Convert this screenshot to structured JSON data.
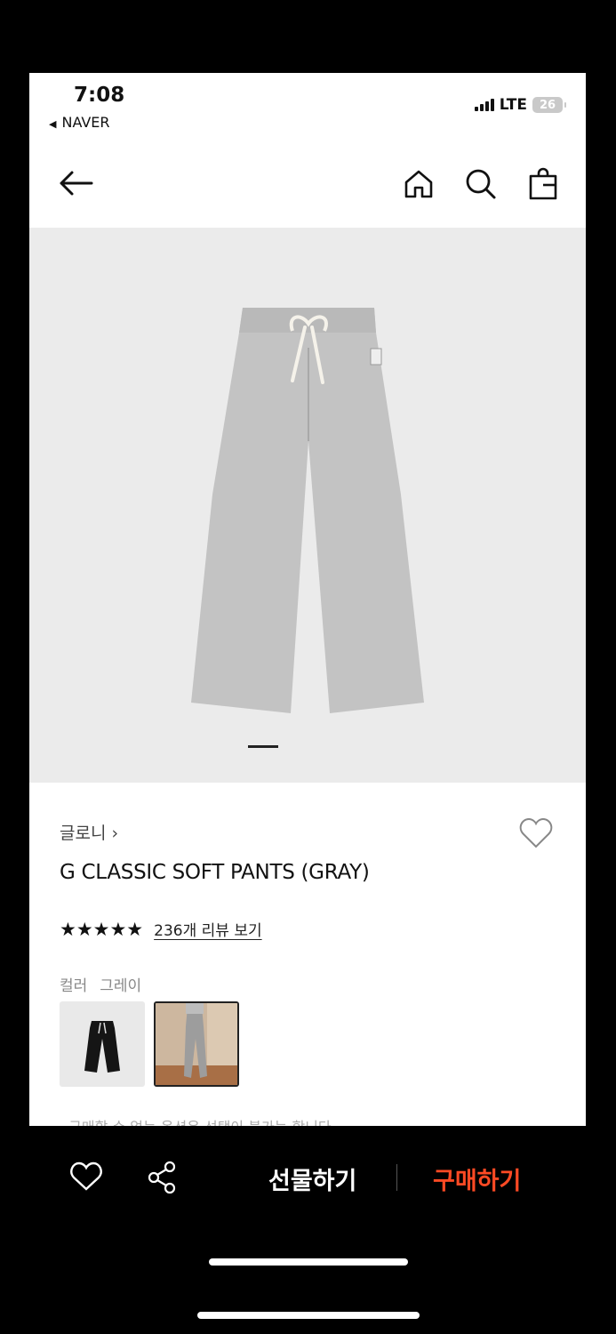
{
  "status_bar": {
    "time": "7:08",
    "back_app": "NAVER",
    "network": "LTE",
    "battery": "26"
  },
  "nav": {
    "back_icon": "arrow-left-icon",
    "home_icon": "home-icon",
    "search_icon": "search-icon",
    "bag_icon": "shopping-bag-icon"
  },
  "product": {
    "brand": "글로니",
    "brand_chevron": "›",
    "title": "G CLASSIC SOFT PANTS (GRAY)",
    "stars": "★★★★★",
    "review_link": "236개 리뷰 보기",
    "color_label": "컬러",
    "color_value": "그레이",
    "cutoff_text": "· 구매할 수 없는 옵션은 선택이 불가능 합니다"
  },
  "bottom_bar": {
    "gift_label": "선물하기",
    "buy_label": "구매하기",
    "buy_color": "#ff4a24"
  }
}
